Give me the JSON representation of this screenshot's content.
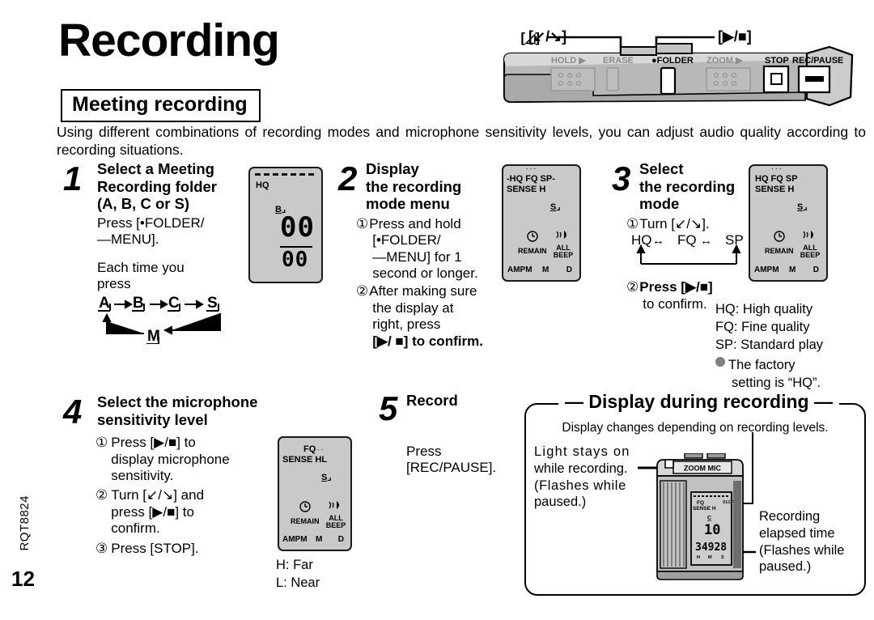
{
  "page": {
    "title": "Recording",
    "section": "Meeting recording",
    "intro": "Using different combinations of recording modes and microphone sensitivity levels, you can adjust audio quality according to recording situations.",
    "doc_code": "RQT8824",
    "page_number": "12"
  },
  "device_art": {
    "callout_left": "[↙/↘]",
    "callout_right": "[▶/■]",
    "buttons": [
      {
        "label": "HOLD ▶",
        "dim": true
      },
      {
        "label": "ERASE",
        "dim": true
      },
      {
        "label": "•FOLDER",
        "dim": false
      },
      {
        "label": "ZOOM ▶",
        "dim": true
      },
      {
        "label": "STOP",
        "dim": false
      },
      {
        "label": "REC/PAUSE",
        "dim": false
      }
    ]
  },
  "steps": [
    {
      "num": "1",
      "title_lines": [
        "Select a Meeting",
        "Recording folder",
        "(A, B, C or S)"
      ],
      "body_lines": [
        "Press [•FOLDER/",
        "—MENU]."
      ],
      "body2_lines": [
        "Each time you",
        "press"
      ],
      "flow": {
        "top": [
          "A",
          "B",
          "C",
          "S"
        ],
        "bottom": "M"
      }
    },
    {
      "num": "2",
      "title_lines": [
        "Display",
        "the recording",
        "mode menu"
      ],
      "items": [
        {
          "marker": "①",
          "lines": [
            "Press and hold",
            "[•FOLDER/",
            "—MENU] for 1",
            "second or longer."
          ]
        },
        {
          "marker": "②",
          "lines": [
            "After making sure",
            "the display at",
            "right, press",
            "[▶/ ■] to confirm."
          ]
        }
      ]
    },
    {
      "num": "3",
      "title_lines": [
        "Select",
        "the recording",
        "mode"
      ],
      "items": [
        {
          "marker": "①",
          "lines": [
            "Turn [↙/↘]."
          ]
        },
        {
          "marker": "②",
          "lines": [
            "Press [▶/■]",
            "to confirm."
          ]
        }
      ],
      "mode_cycle": [
        "HQ",
        "FQ",
        "SP"
      ],
      "legend": [
        "HQ: High quality",
        "FQ: Fine quality",
        "SP: Standard play"
      ],
      "legend_note": [
        "The factory",
        "setting is “HQ”."
      ]
    },
    {
      "num": "4",
      "title_lines": [
        "Select the microphone",
        "sensitivity level"
      ],
      "items": [
        {
          "marker": "①",
          "lines": [
            "Press [▶/■] to",
            "display microphone",
            "sensitivity."
          ]
        },
        {
          "marker": "②",
          "lines": [
            "Turn [↙/↘] and",
            "press [▶/■] to",
            "confirm."
          ]
        },
        {
          "marker": "③",
          "lines": [
            "Press [STOP]."
          ]
        }
      ],
      "legend": [
        "H: Far",
        "L: Near"
      ]
    },
    {
      "num": "5",
      "title_lines": [
        "Record"
      ],
      "body_lines": [
        "Press",
        "[REC/PAUSE]."
      ]
    }
  ],
  "lcds": {
    "step1": {
      "dashed_top": true,
      "mode": "HQ",
      "folder": "B",
      "digits_main": "00",
      "digits_sub": "00"
    },
    "step2": {
      "modes": "HQ FQ SP",
      "modes_blinking": true,
      "sense": "SENSE H",
      "folder": "S",
      "remain": "REMAIN",
      "all": "ALL",
      "beep": "BEEP",
      "ampm": "AMPM",
      "month": "M",
      "day": "D"
    },
    "step3": {
      "modes": "HQ FQ SP",
      "modes_blinking": true,
      "sense": "SENSE H",
      "folder": "S",
      "remain": "REMAIN",
      "all": "ALL",
      "beep": "BEEP",
      "ampm": "AMPM",
      "month": "M",
      "day": "D"
    },
    "step4": {
      "mode": "FQ",
      "sense_label": "SENSE",
      "sense_h": "H",
      "sense_l": "L",
      "sense_h_blinking": true,
      "folder": "S",
      "remain": "REMAIN",
      "all": "ALL",
      "beep": "BEEP",
      "ampm": "AMPM",
      "month": "M",
      "day": "D"
    },
    "recording": {
      "mic_label": "ZOOM MIC",
      "mode": "FQ",
      "sense": "SENSE H",
      "folder": "C",
      "file_no": "10",
      "elapsed": "34928",
      "unit_h": "H",
      "unit_m": "M",
      "unit_s": "S"
    }
  },
  "display_during_recording": {
    "title": "Display during recording",
    "subtitle": "Display changes depending on recording levels.",
    "left_note": [
      "Light stays on",
      "while recording.",
      "(Flashes while",
      "paused.)"
    ],
    "right_note": [
      "Recording",
      "elapsed time",
      "(Flashes while",
      "paused.)"
    ]
  },
  "colors": {
    "lcd_bg": "#c9c9c9",
    "device_body": "#b4b4b4",
    "device_dim_text": "#8c8c8c",
    "gray_bullet": "#808080"
  }
}
